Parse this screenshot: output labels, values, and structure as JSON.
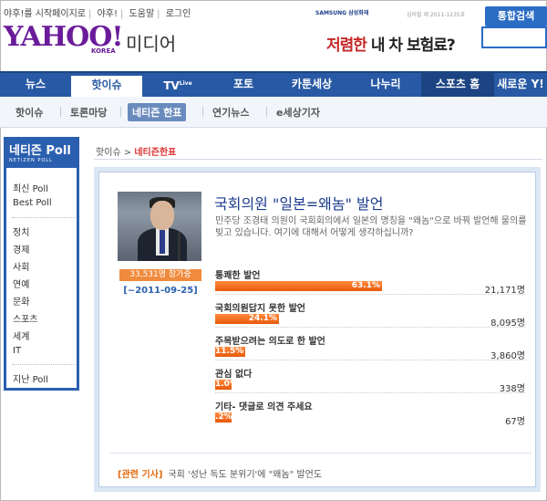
{
  "util_links": [
    "야후!를 시작페이지로",
    "야후!",
    "도움말",
    "로그인"
  ],
  "sponsor": "SAMSUNG 삼성화재",
  "notice": "심의필 제 2011-1235호",
  "logo": {
    "text": "YAHOO!",
    "sub": "KOREA",
    "section": "미디어"
  },
  "ad": {
    "pre": "저렴한",
    "post": " 내 차 보험료?"
  },
  "search_button": "통합검색",
  "nav": [
    "뉴스",
    "핫이슈",
    "TV",
    "포토",
    "카툰세상",
    "나누리",
    "스포츠 홈",
    "새로운 Y!"
  ],
  "nav_tv_sup": "Live",
  "subnav": [
    "핫이슈",
    "토론마당",
    "네티즌 한표",
    "연기뉴스",
    "e세상기자"
  ],
  "sidebar": {
    "title": "네티즌 Poll",
    "subtitle": "NETIZEN POLL",
    "items": [
      "최신 Poll",
      "Best Poll",
      "정치",
      "경제",
      "사회",
      "연예",
      "문화",
      "스포츠",
      "세계",
      "IT",
      "지난 Poll"
    ]
  },
  "breadcrumb": {
    "parent": "핫이슈",
    "current": "네티즌한표"
  },
  "poll": {
    "title": "국회의원 \"일본=왜놈\" 발언",
    "description": "민주당 조경태 의원이 국회회의에서 일본의 명칭을 \"왜놈\"으로 바꿔 발언해 물의를 빚고 있습니다. 여기에 대해서 어떻게 생각하십니까?",
    "participants": "33,531명 참가중",
    "period": "[~2011-09-25]",
    "options": [
      {
        "label": "통쾌한 발언",
        "percent": "63.1%",
        "value": 63.1,
        "count": "21,171명"
      },
      {
        "label": "국회의원답지 못한 발언",
        "percent": "24.1%",
        "value": 24.1,
        "count": "8,095명"
      },
      {
        "label": "주목받으려는 의도로 한 발언",
        "percent": "11.5%",
        "value": 11.5,
        "count": "3,860명"
      },
      {
        "label": "관심 없다",
        "percent": "1.0%",
        "value": 1.0,
        "count": "338명"
      },
      {
        "label": "기타- 댓글로 의견 주세요",
        "percent": ".2%",
        "value": 0.2,
        "count": "67명"
      }
    ]
  },
  "related": {
    "tag": "[관련 기사]",
    "text": "국회 '성난 독도 분위기'에 \"왜놈\" 발언도"
  },
  "colors": {
    "nav": "#2859a4",
    "bar": "#f07020",
    "accent": "#d33333",
    "brand": "#6a1b9a"
  }
}
